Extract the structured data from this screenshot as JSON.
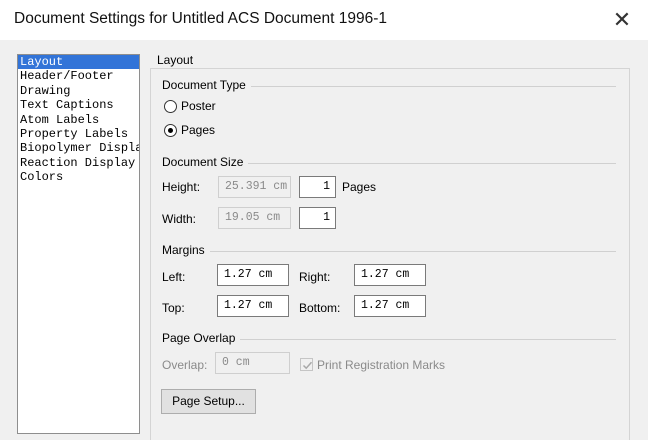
{
  "window": {
    "title": "Document Settings for Untitled ACS Document 1996-1",
    "close_glyph": "✕"
  },
  "nav": {
    "items": [
      {
        "label": "Layout",
        "selected": true
      },
      {
        "label": "Header/Footer"
      },
      {
        "label": "Drawing"
      },
      {
        "label": "Text Captions"
      },
      {
        "label": "Atom Labels"
      },
      {
        "label": "Property Labels"
      },
      {
        "label": "Biopolymer Displa"
      },
      {
        "label": "Reaction Display"
      },
      {
        "label": "Colors"
      }
    ]
  },
  "layout": {
    "section_title": "Layout",
    "document_type": {
      "title": "Document Type",
      "options": [
        {
          "label": "Poster",
          "checked": false
        },
        {
          "label": "Pages",
          "checked": true
        }
      ]
    },
    "document_size": {
      "title": "Document Size",
      "height_label": "Height:",
      "height_value": "25.391 cm",
      "height_pages": "1",
      "pages_label": "Pages",
      "width_label": "Width:",
      "width_value": "19.05 cm",
      "width_pages": "1"
    },
    "margins": {
      "title": "Margins",
      "left_label": "Left:",
      "left_value": "1.27 cm",
      "right_label": "Right:",
      "right_value": "1.27 cm",
      "top_label": "Top:",
      "top_value": "1.27 cm",
      "bottom_label": "Bottom:",
      "bottom_value": "1.27 cm"
    },
    "page_overlap": {
      "title": "Page Overlap",
      "overlap_label": "Overlap:",
      "overlap_value": "0 cm",
      "print_marks_label": "Print Registration Marks",
      "print_marks_checked": true
    },
    "page_setup_button": "Page Setup..."
  }
}
